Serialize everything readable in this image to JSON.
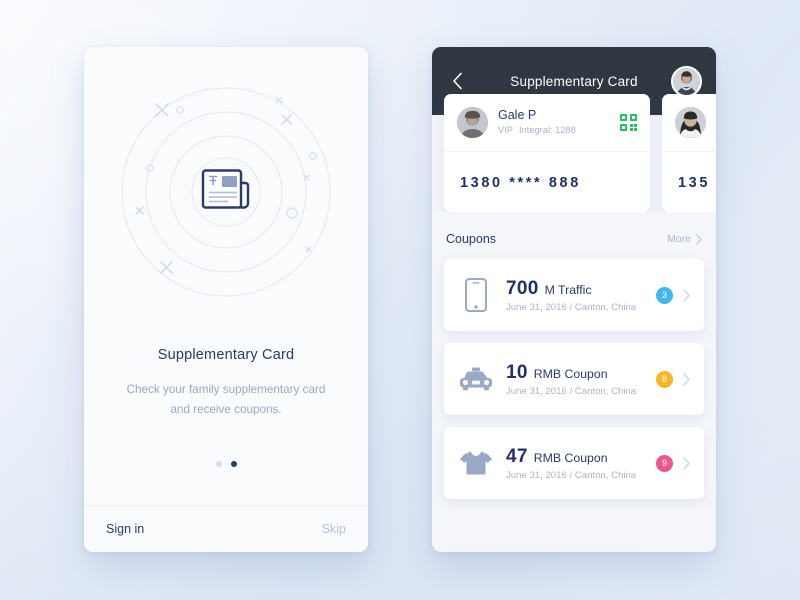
{
  "theme": {
    "bg_start": "#eef3fb",
    "bg_end": "#dfe8f6",
    "navy": "#22306a",
    "muted": "#aab5cb",
    "navbar_dark": "#2f3743",
    "qr_green": "#22c55e"
  },
  "onboarding": {
    "illustration_icon": "newspaper-icon",
    "title": "Supplementary Card",
    "subtitle": "Check your family supplementary card and receive coupons.",
    "dots": [
      {
        "name": "page-dot-1",
        "active": false
      },
      {
        "name": "page-dot-2",
        "active": true
      }
    ],
    "sign_in_label": "Sign in",
    "skip_label": "Skip"
  },
  "card_screen": {
    "nav": {
      "back_icon": "chevron-left-icon",
      "title": "Supplementary Card",
      "avatar_icon": "user-avatar"
    },
    "member_cards": [
      {
        "avatar_icon": "avatar-male",
        "name": "Gale P",
        "tier": "VIP",
        "integral_label": "Integral: 1288",
        "qr_icon": "qr-code-icon",
        "number": "1380 **** 888"
      },
      {
        "avatar_icon": "avatar-female",
        "name": "",
        "tier": "",
        "integral_label": "",
        "qr_icon": "qr-code-icon",
        "number": "135"
      }
    ],
    "coupons_section": {
      "title": "Coupons",
      "more_label": "More",
      "more_icon": "chevron-right-icon"
    },
    "coupons": [
      {
        "icon": "smartphone-icon",
        "amount": "700",
        "unit": "M Traffic",
        "sub": "June 31, 2016 / Canton, China",
        "badge_count": "3",
        "badge_color": "#3fb9ed",
        "chevron_icon": "chevron-right-icon"
      },
      {
        "icon": "taxi-icon",
        "amount": "10",
        "unit": "RMB Coupon",
        "sub": "June 31, 2016 / Canton, China",
        "badge_count": "8",
        "badge_color": "#f5b824",
        "chevron_icon": "chevron-right-icon"
      },
      {
        "icon": "tshirt-icon",
        "amount": "47",
        "unit": "RMB Coupon",
        "sub": "June 31, 2016 / Canton, China",
        "badge_count": "9",
        "badge_color": "#f2558c",
        "chevron_icon": "chevron-right-icon"
      }
    ]
  }
}
